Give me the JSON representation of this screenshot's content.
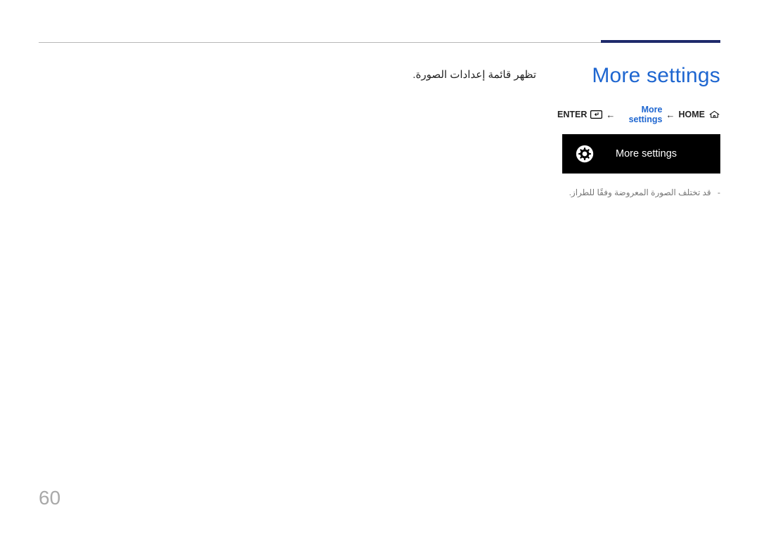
{
  "header": {},
  "section": {
    "title": "More settings",
    "breadcrumb": {
      "enter": "ENTER",
      "item": "More settings",
      "home": "HOME",
      "arrow": "←"
    },
    "menu": {
      "label": "More settings"
    },
    "note": "قد تختلف الصورة المعروضة وفقًا للطراز.",
    "note_prefix": "-"
  },
  "left": {
    "desc": "تظهر قائمة إعدادات الصورة."
  },
  "page_number": "60"
}
